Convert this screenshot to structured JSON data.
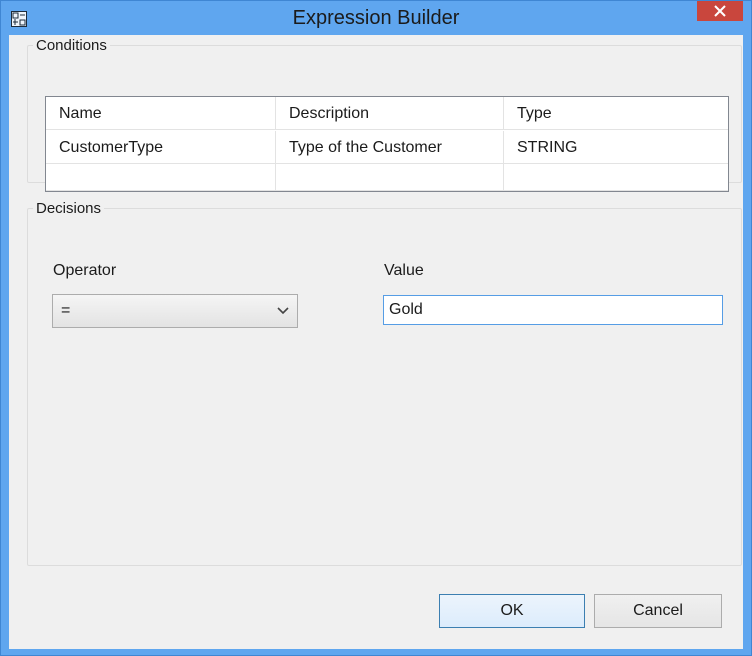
{
  "window": {
    "title": "Expression Builder",
    "icon": "expression-builder-icon",
    "close_icon": "close-icon"
  },
  "conditions": {
    "group_label": "Conditions",
    "columns": [
      "Name",
      "Description",
      "Type"
    ],
    "rows": [
      [
        "CustomerType",
        "Type of the Customer",
        "STRING"
      ],
      [
        "",
        "",
        ""
      ]
    ]
  },
  "decisions": {
    "group_label": "Decisions",
    "operator_label": "Operator",
    "operator_value": "=",
    "value_label": "Value",
    "value": "Gold"
  },
  "buttons": {
    "ok": "OK",
    "cancel": "Cancel"
  },
  "colors": {
    "titlebar": "#5fa6ef",
    "close": "#c9463d",
    "dialog_bg": "#f0f0f0",
    "focus_border": "#569de5"
  }
}
